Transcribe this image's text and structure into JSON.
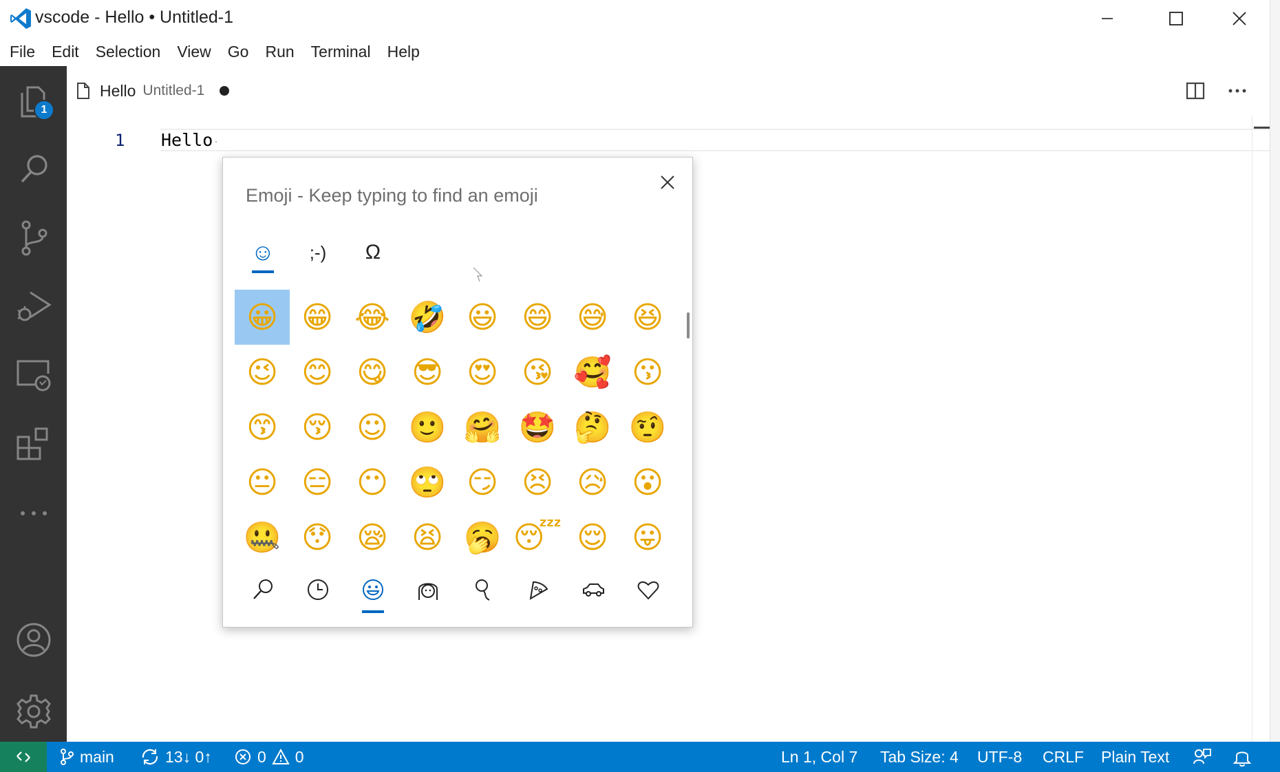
{
  "window": {
    "title": "vscode - Hello • Untitled-1",
    "accent": "#007acc"
  },
  "menu": {
    "items": [
      "File",
      "Edit",
      "Selection",
      "View",
      "Go",
      "Run",
      "Terminal",
      "Help"
    ]
  },
  "activity_bar": {
    "items": [
      {
        "name": "explorer-icon",
        "badge": "1"
      },
      {
        "name": "search-icon"
      },
      {
        "name": "source-control-icon"
      },
      {
        "name": "run-debug-icon"
      },
      {
        "name": "remote-explorer-icon"
      },
      {
        "name": "extensions-icon"
      },
      {
        "name": "more-icon"
      },
      {
        "name": "accounts-icon"
      },
      {
        "name": "settings-gear-icon"
      }
    ]
  },
  "editor": {
    "tab_name": "Hello",
    "tab_description": "Untitled-1",
    "line_number": "1",
    "line_text": "Hello"
  },
  "emoji_panel": {
    "placeholder": "Emoji - Keep typing to find an emoji",
    "top_tabs": [
      {
        "name": "emoji-tab-icon",
        "glyph": "☺"
      },
      {
        "name": "kaomoji-tab-icon",
        "glyph": ";-)"
      },
      {
        "name": "symbols-tab-icon",
        "glyph": "Ω"
      }
    ],
    "emojis": [
      "😀",
      "😁",
      "😂",
      "🤣",
      "😃",
      "😄",
      "😅",
      "😆",
      "😉",
      "😊",
      "😋",
      "😎",
      "😍",
      "😘",
      "🥰",
      "😗",
      "😙",
      "😚",
      "☺",
      "🙂",
      "🤗",
      "🤩",
      "🤔",
      "🤨",
      "😐",
      "😑",
      "😶",
      "🙄",
      "😏",
      "😣",
      "😥",
      "😮",
      "🤐",
      "😯",
      "😪",
      "😫",
      "🥱",
      "😴",
      "😌",
      "😛"
    ],
    "bottom_tabs": [
      "search-icon",
      "recent-icon",
      "smiley-icon",
      "people-icon",
      "celebration-icon",
      "food-icon",
      "travel-icon",
      "heart-icon"
    ]
  },
  "status_bar": {
    "branch": "main",
    "sync": "13↓ 0↑",
    "errors": "0",
    "warnings": "0",
    "position": "Ln 1, Col 7",
    "tab_size": "Tab Size: 4",
    "encoding": "UTF-8",
    "eol": "CRLF",
    "language": "Plain Text"
  }
}
